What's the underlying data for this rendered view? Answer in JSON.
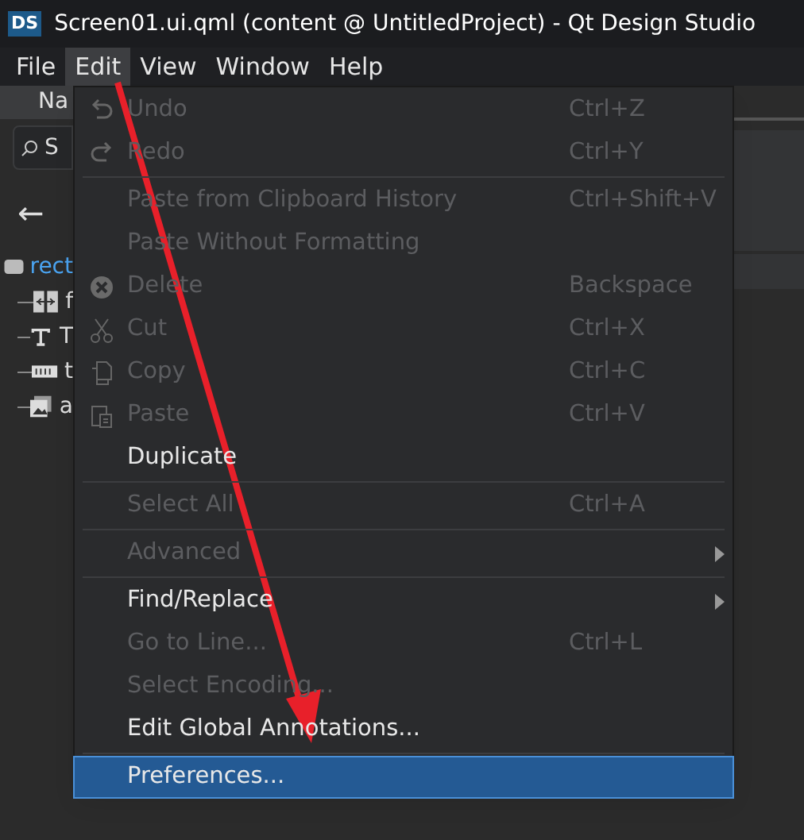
{
  "window": {
    "title": "Screen01.ui.qml (content @ UntitledProject) - Qt Design Studio",
    "app_badge": "DS"
  },
  "menubar": [
    {
      "label": "File",
      "selected": false
    },
    {
      "label": "Edit",
      "selected": true
    },
    {
      "label": "View",
      "selected": false
    },
    {
      "label": "Window",
      "selected": false
    },
    {
      "label": "Help",
      "selected": false
    }
  ],
  "background_panel": {
    "tab": "Na",
    "search": "S",
    "back": "←",
    "tree": [
      {
        "label": "rect",
        "children": [
          {
            "label": "f"
          },
          {
            "label": "T"
          },
          {
            "label": "t"
          },
          {
            "label": "a"
          }
        ]
      }
    ]
  },
  "edit_menu": [
    {
      "kind": "item",
      "label": "Undo",
      "shortcut": "Ctrl+Z",
      "disabled": true,
      "submenu": false,
      "selected": false
    },
    {
      "kind": "item",
      "label": "Redo",
      "shortcut": "Ctrl+Y",
      "disabled": true,
      "submenu": false,
      "selected": false
    },
    {
      "kind": "separator"
    },
    {
      "kind": "item",
      "label": "Paste from Clipboard History",
      "shortcut": "Ctrl+Shift+V",
      "disabled": true,
      "submenu": false,
      "selected": false
    },
    {
      "kind": "item",
      "label": "Paste Without Formatting",
      "disabled": true,
      "submenu": false,
      "selected": false
    },
    {
      "kind": "item",
      "label": "Delete",
      "shortcut": "Backspace",
      "disabled": true,
      "submenu": false,
      "selected": false
    },
    {
      "kind": "item",
      "label": "Cut",
      "shortcut": "Ctrl+X",
      "disabled": true,
      "submenu": false,
      "selected": false
    },
    {
      "kind": "item",
      "label": "Copy",
      "shortcut": "Ctrl+C",
      "disabled": true,
      "submenu": false,
      "selected": false
    },
    {
      "kind": "item",
      "label": "Paste",
      "shortcut": "Ctrl+V",
      "disabled": true,
      "submenu": false,
      "selected": false
    },
    {
      "kind": "item",
      "label": "Duplicate",
      "disabled": false,
      "submenu": false,
      "selected": false
    },
    {
      "kind": "separator"
    },
    {
      "kind": "item",
      "label": "Select All",
      "shortcut": "Ctrl+A",
      "disabled": true,
      "submenu": false,
      "selected": false
    },
    {
      "kind": "separator"
    },
    {
      "kind": "item",
      "label": "Advanced",
      "disabled": true,
      "submenu": true,
      "selected": false
    },
    {
      "kind": "separator"
    },
    {
      "kind": "item",
      "label": "Find/Replace",
      "disabled": false,
      "submenu": true,
      "selected": false
    },
    {
      "kind": "item",
      "label": "Go to Line...",
      "shortcut": "Ctrl+L",
      "disabled": true,
      "submenu": false,
      "selected": false
    },
    {
      "kind": "item",
      "label": "Select Encoding...",
      "disabled": true,
      "submenu": false,
      "selected": false
    },
    {
      "kind": "item",
      "label": "Edit Global Annotations...",
      "disabled": false,
      "submenu": false,
      "selected": false
    },
    {
      "kind": "separator"
    },
    {
      "kind": "item",
      "label": "Preferences...",
      "disabled": false,
      "submenu": false,
      "selected": true
    }
  ]
}
